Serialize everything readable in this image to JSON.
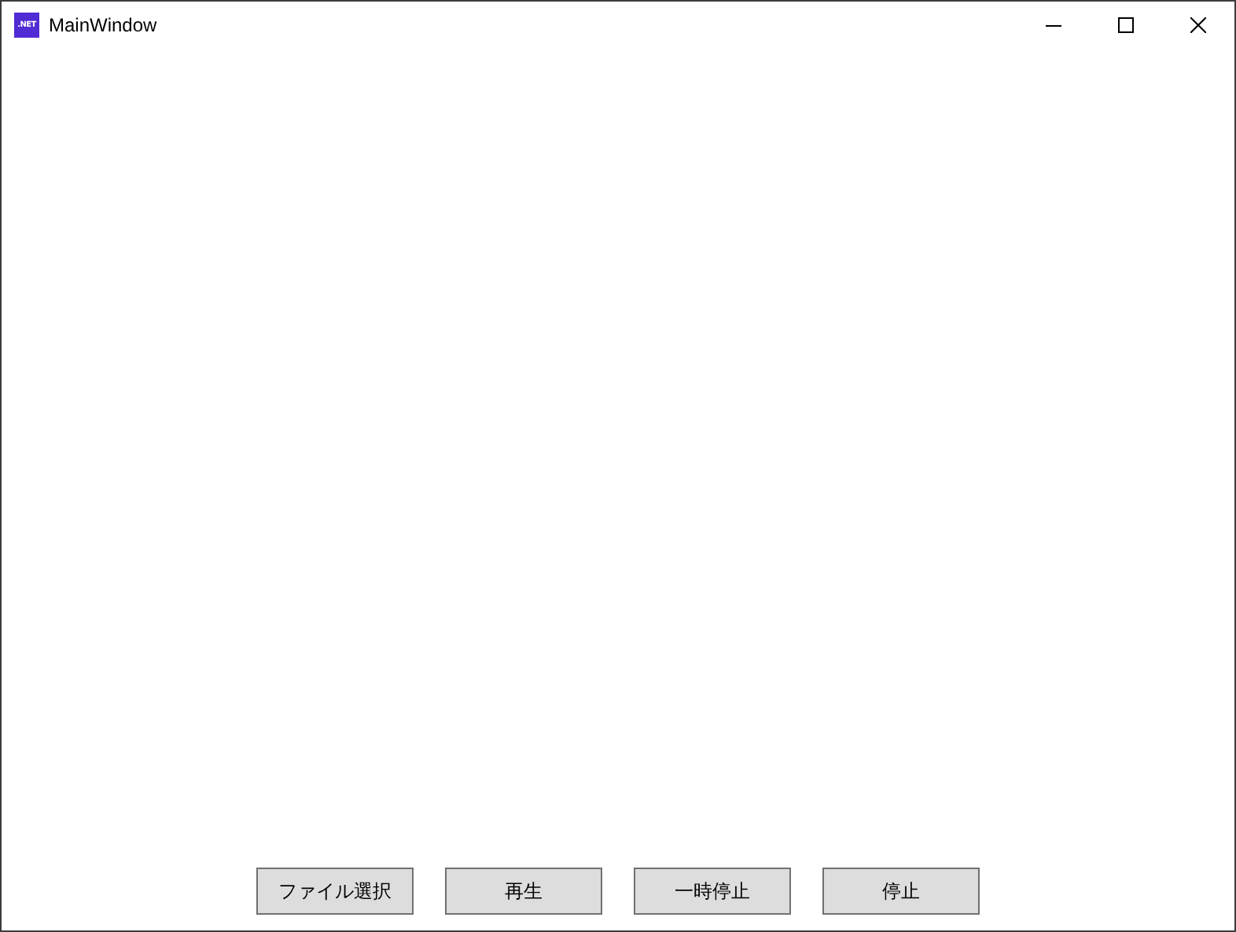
{
  "window": {
    "title": "MainWindow",
    "logo_text": ".NET"
  },
  "buttons": [
    {
      "label": "ファイル選択"
    },
    {
      "label": "再生"
    },
    {
      "label": "一時停止"
    },
    {
      "label": "停止"
    }
  ]
}
